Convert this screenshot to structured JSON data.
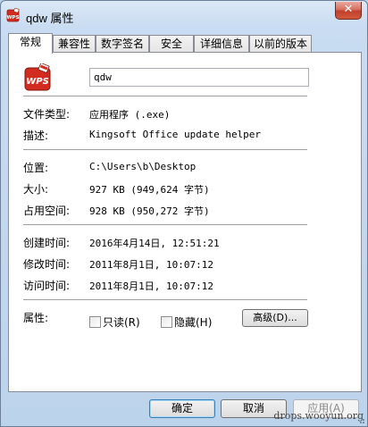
{
  "window": {
    "title": "qdw 属性",
    "close_label": "✕"
  },
  "tabs": [
    {
      "label": "常规",
      "active": true
    },
    {
      "label": "兼容性",
      "active": false
    },
    {
      "label": "数字签名",
      "active": false
    },
    {
      "label": "安全",
      "active": false
    },
    {
      "label": "详细信息",
      "active": false
    },
    {
      "label": "以前的版本",
      "active": false
    }
  ],
  "general": {
    "file_name": "qdw",
    "file_type_label": "文件类型:",
    "file_type_value": "应用程序 (.exe)",
    "description_label": "描述:",
    "description_value": "Kingsoft Office update helper",
    "location_label": "位置:",
    "location_value": "C:\\Users\\b\\Desktop",
    "size_label": "大小:",
    "size_value": "927 KB (949,624 字节)",
    "size_on_disk_label": "占用空间:",
    "size_on_disk_value": "928 KB (950,272 字节)",
    "created_label": "创建时间:",
    "created_value": "2016年4月14日, 12:51:21",
    "modified_label": "修改时间:",
    "modified_value": "2011年8月1日, 10:07:12",
    "accessed_label": "访问时间:",
    "accessed_value": "2011年8月1日, 10:07:12",
    "attributes_label": "属性:",
    "readonly_label": "只读(R)",
    "hidden_label": "隐藏(H)",
    "advanced_label": "高级(D)..."
  },
  "buttons": {
    "ok": "确定",
    "cancel": "取消",
    "apply": "应用(A)"
  },
  "watermark": "drops.wooyun.org",
  "colors": {
    "wps_red": "#d22b1f",
    "close_red": "#c1402c"
  }
}
